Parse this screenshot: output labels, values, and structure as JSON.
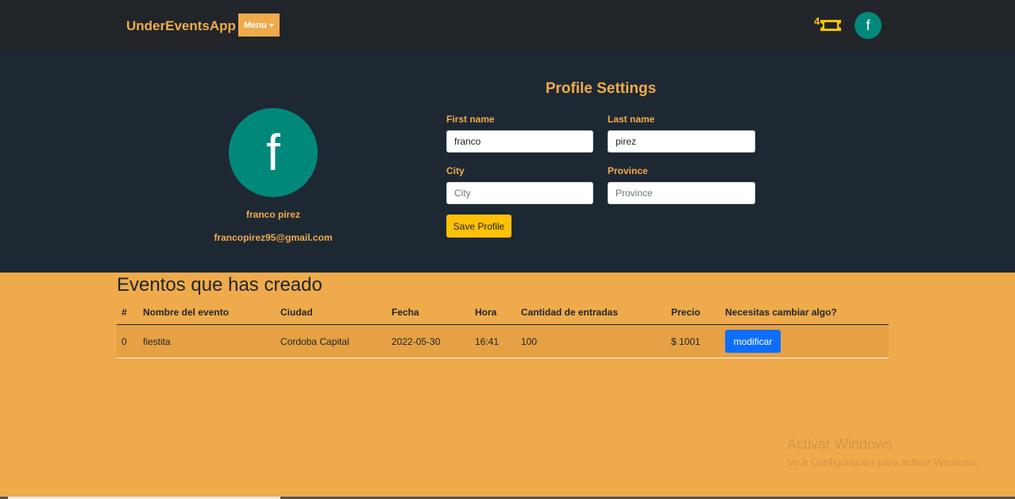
{
  "navbar": {
    "brand": "UnderEventsApp",
    "menu_label": "Menu",
    "ticket_count": "4",
    "avatar_letter": "f",
    "colors": {
      "background": "#212529",
      "accent": "#EFAB4B",
      "ticket": "#FFC107",
      "avatar": "#00897B"
    }
  },
  "profile": {
    "avatar_letter": "f",
    "name": "franco pirez",
    "email": "francopirez95@gmail.com",
    "settings_title": "Profile Settings",
    "fields": {
      "first_name": {
        "label": "First name",
        "value": "franco",
        "placeholder": ""
      },
      "last_name": {
        "label": "Last name",
        "value": "pirez",
        "placeholder": ""
      },
      "city": {
        "label": "City",
        "value": "",
        "placeholder": "City"
      },
      "province": {
        "label": "Province",
        "value": "",
        "placeholder": "Province"
      }
    },
    "save_label": "Save Profile"
  },
  "events": {
    "title": "Eventos que has creado",
    "columns": [
      "#",
      "Nombre del evento",
      "Ciudad",
      "Fecha",
      "Hora",
      "Cantidad de entradas",
      "Precio",
      "Necesitas cambiar algo?"
    ],
    "rows": [
      {
        "index": "0",
        "name": "fiestita",
        "city": "Cordoba Capital",
        "date": "2022-05-30",
        "time": "16:41",
        "tickets": "100",
        "price": "$ 1001",
        "action": "modificar"
      }
    ]
  },
  "watermark": {
    "title": "Activar Windows",
    "subtitle": "Ve a Configuración para activar Windows."
  }
}
